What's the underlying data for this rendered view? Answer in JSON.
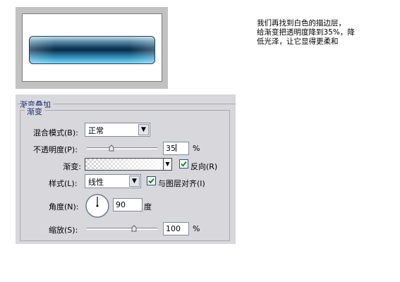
{
  "note": {
    "lines": [
      "我们再找到白色的描边层，",
      "给渐变把透明度降到35%，降",
      "低光泽，让它显得更柔和"
    ]
  },
  "panel": {
    "group_title": "渐变叠加",
    "section_title": "渐变",
    "blend_mode": {
      "label": "混合模式(B):",
      "value": "正常"
    },
    "opacity": {
      "label": "不透明度(P):",
      "value": "35",
      "unit": "%",
      "level": 0.35
    },
    "gradient": {
      "label": "渐变:",
      "reverse_label": "反向(R)",
      "reverse_checked": true
    },
    "style": {
      "label": "样式(L):",
      "value": "线性",
      "align_label": "与图层对齐(I)",
      "align_checked": true
    },
    "angle": {
      "label": "角度(N):",
      "value": "90",
      "unit": "度",
      "degrees": 90
    },
    "scale": {
      "label": "缩放(S):",
      "value": "100",
      "unit": "%",
      "level": 0.67
    }
  },
  "colors": {
    "panel_bg": "#d8d8dc",
    "title_blue": "#1a2a6e",
    "check_green": "#1a8a1a"
  }
}
